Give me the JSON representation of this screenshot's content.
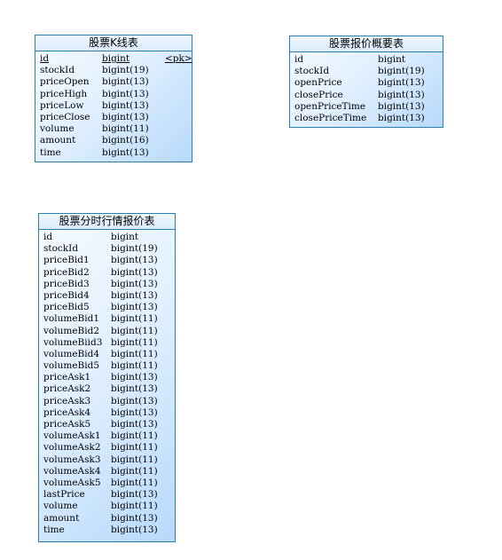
{
  "entities": [
    {
      "id": "kline",
      "title": "股票K线表",
      "attributes": [
        {
          "name": "id",
          "type": "bigint",
          "key": "<pk>",
          "underline": true
        },
        {
          "name": "stockId",
          "type": "bigint(19)"
        },
        {
          "name": "priceOpen",
          "type": "bigint(13)"
        },
        {
          "name": "priceHigh",
          "type": "bigint(13)"
        },
        {
          "name": "priceLow",
          "type": "bigint(13)"
        },
        {
          "name": "priceClose",
          "type": "bigint(13)"
        },
        {
          "name": "volume",
          "type": "bigint(11)"
        },
        {
          "name": "amount",
          "type": "bigint(16)"
        },
        {
          "name": "time",
          "type": "bigint(13)"
        }
      ]
    },
    {
      "id": "quote-summary",
      "title": "股票报价概要表",
      "attributes": [
        {
          "name": "id",
          "type": "bigint"
        },
        {
          "name": "stockId",
          "type": "bigint(19)"
        },
        {
          "name": "openPrice",
          "type": "bigint(13)"
        },
        {
          "name": "closePrice",
          "type": "bigint(13)"
        },
        {
          "name": "openPriceTime",
          "type": "bigint(13)"
        },
        {
          "name": "closePriceTime",
          "type": "bigint(13)"
        }
      ]
    },
    {
      "id": "intraday-quote",
      "title": "股票分时行情报价表",
      "attributes": [
        {
          "name": "id",
          "type": "bigint"
        },
        {
          "name": "stockId",
          "type": "bigint(19)"
        },
        {
          "name": "priceBid1",
          "type": "bigint(13)"
        },
        {
          "name": "priceBid2",
          "type": "bigint(13)"
        },
        {
          "name": "priceBid3",
          "type": "bigint(13)"
        },
        {
          "name": "priceBid4",
          "type": "bigint(13)"
        },
        {
          "name": "priceBid5",
          "type": "bigint(13)"
        },
        {
          "name": "volumeBid1",
          "type": "bigint(11)"
        },
        {
          "name": "volumeBid2",
          "type": "bigint(11)"
        },
        {
          "name": "volumeBiid3",
          "type": "bigint(11)"
        },
        {
          "name": "volumeBid4",
          "type": "bigint(11)"
        },
        {
          "name": "volumeBid5",
          "type": "bigint(11)"
        },
        {
          "name": "priceAsk1",
          "type": "bigint(13)"
        },
        {
          "name": "priceAsk2",
          "type": "bigint(13)"
        },
        {
          "name": "priceAsk3",
          "type": "bigint(13)"
        },
        {
          "name": "priceAsk4",
          "type": "bigint(13)"
        },
        {
          "name": "priceAsk5",
          "type": "bigint(13)"
        },
        {
          "name": "volumeAsk1",
          "type": "bigint(11)"
        },
        {
          "name": "volumeAsk2",
          "type": "bigint(11)"
        },
        {
          "name": "volumeAsk3",
          "type": "bigint(11)"
        },
        {
          "name": "volumeAsk4",
          "type": "bigint(11)"
        },
        {
          "name": "volumeAsk5",
          "type": "bigint(11)"
        },
        {
          "name": "lastPrice",
          "type": "bigint(13)"
        },
        {
          "name": "volume",
          "type": "bigint(11)"
        },
        {
          "name": "amount",
          "type": "bigint(13)"
        },
        {
          "name": "time",
          "type": "bigint(13)"
        }
      ]
    }
  ]
}
